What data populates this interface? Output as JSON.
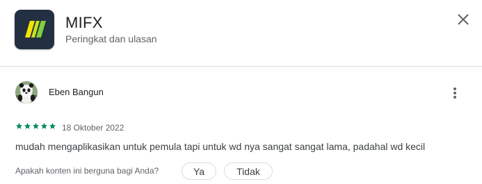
{
  "app": {
    "name": "MIFX",
    "subtitle": "Peringkat dan ulasan",
    "icon": "mifx-logo"
  },
  "header_icons": {
    "close": "close-icon"
  },
  "review": {
    "reviewer_name": "Eben Bangun",
    "avatar": "panda-avatar",
    "rating": 5,
    "max_rating": 5,
    "date": "18 Oktober 2022",
    "text": "mudah mengaplikasikan untuk pemula tapi untuk wd nya sangat sangat lama, padahal wd kecil",
    "menu_icon": "more-vert-icon"
  },
  "helpful": {
    "question": "Apakah konten ini berguna bagi Anda?",
    "yes_label": "Ya",
    "no_label": "Tidak"
  },
  "colors": {
    "star": "#01875f",
    "icon_bg": "#233041",
    "logo_yellow": "#f5e400",
    "logo_green": "#7fd13b",
    "divider": "#dadce0"
  }
}
